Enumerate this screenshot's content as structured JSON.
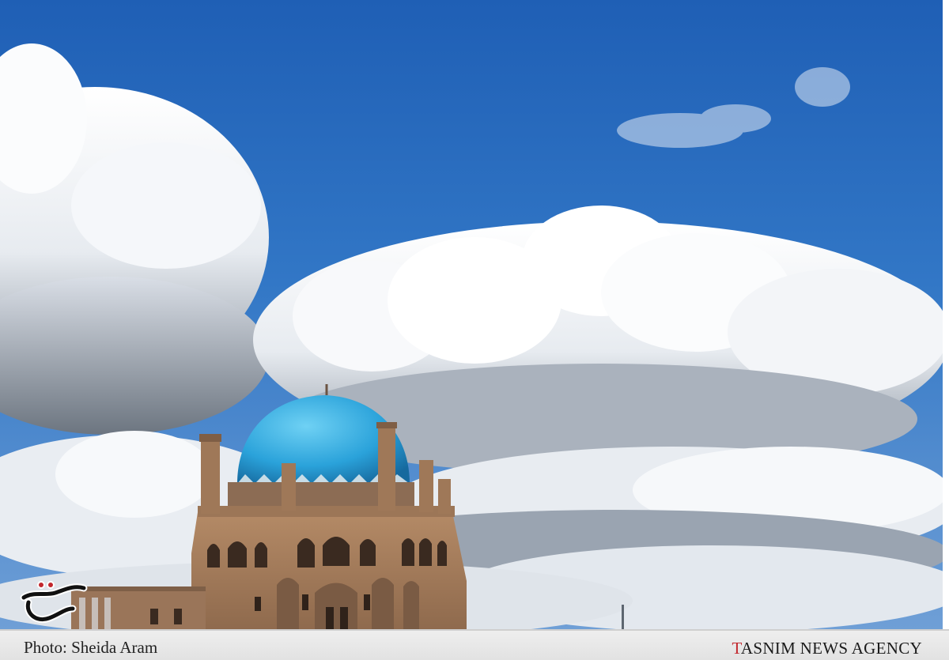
{
  "photo": {
    "subject": "dome-of-soltaniyeh",
    "sky_color": "#2f6fbe",
    "dome_color": "#2fa9df",
    "brick_color": "#a67d5c"
  },
  "caption": {
    "credit": "Photo: Sheida Aram",
    "agency_initial": "T",
    "agency_rest": "ASNIM NEWS AGENCY",
    "accent_color": "#c2272d"
  },
  "watermark": {
    "icon": "tasnim-calligraphy-logo"
  }
}
